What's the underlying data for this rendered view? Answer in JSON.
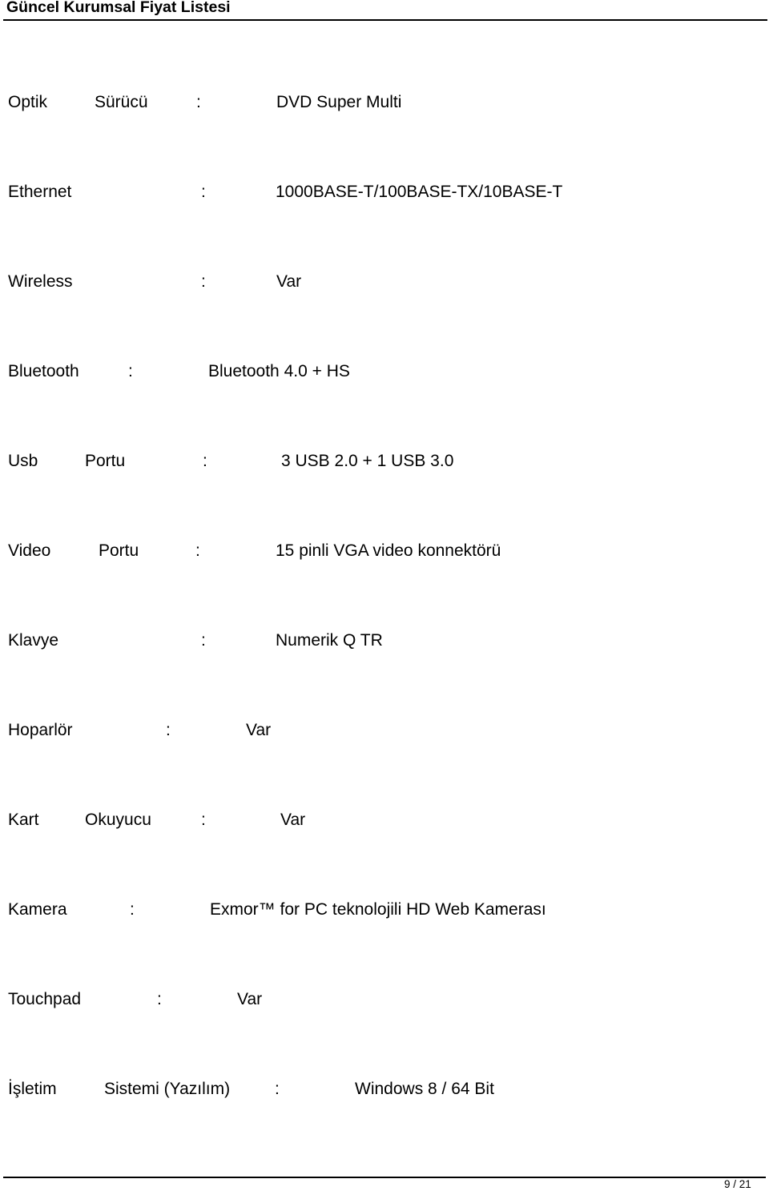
{
  "header": {
    "title": "Güncel Kurumsal Fiyat Listesi"
  },
  "specs": [
    {
      "label_parts": [
        "Optik",
        "Sürücü"
      ],
      "separator": ":",
      "value": "DVD Super Multi"
    },
    {
      "label_parts": [
        "Ethernet"
      ],
      "separator": ":",
      "value": "1000BASE-T/100BASE-TX/10BASE-T"
    },
    {
      "label_parts": [
        "Wireless"
      ],
      "separator": ":",
      "value": "Var"
    },
    {
      "label_parts": [
        "Bluetooth"
      ],
      "separator": ":",
      "value": "Bluetooth 4.0 + HS"
    },
    {
      "label_parts": [
        "Usb",
        "Portu"
      ],
      "separator": ":",
      "value": "3 USB 2.0 + 1 USB 3.0"
    },
    {
      "label_parts": [
        "Video",
        "Portu"
      ],
      "separator": ":",
      "value": "15 pinli VGA video konnektörü"
    },
    {
      "label_parts": [
        "Klavye"
      ],
      "separator": ":",
      "value": "Numerik Q TR"
    },
    {
      "label_parts": [
        "Hoparlör"
      ],
      "separator": ":",
      "value": "Var"
    },
    {
      "label_parts": [
        "Kart",
        "Okuyucu"
      ],
      "separator": ":",
      "value": "Var"
    },
    {
      "label_parts": [
        "Kamera"
      ],
      "separator": ":",
      "value": "Exmor™ for PC teknolojili HD Web Kamerası"
    },
    {
      "label_parts": [
        "Touchpad"
      ],
      "separator": ":",
      "value": "Var"
    },
    {
      "label_parts": [
        "İşletim",
        "Sistemi (Yazılım)"
      ],
      "separator": ":",
      "value": "Windows 8 / 64 Bit"
    }
  ],
  "footer": {
    "page_indicator": "9 / 21"
  }
}
